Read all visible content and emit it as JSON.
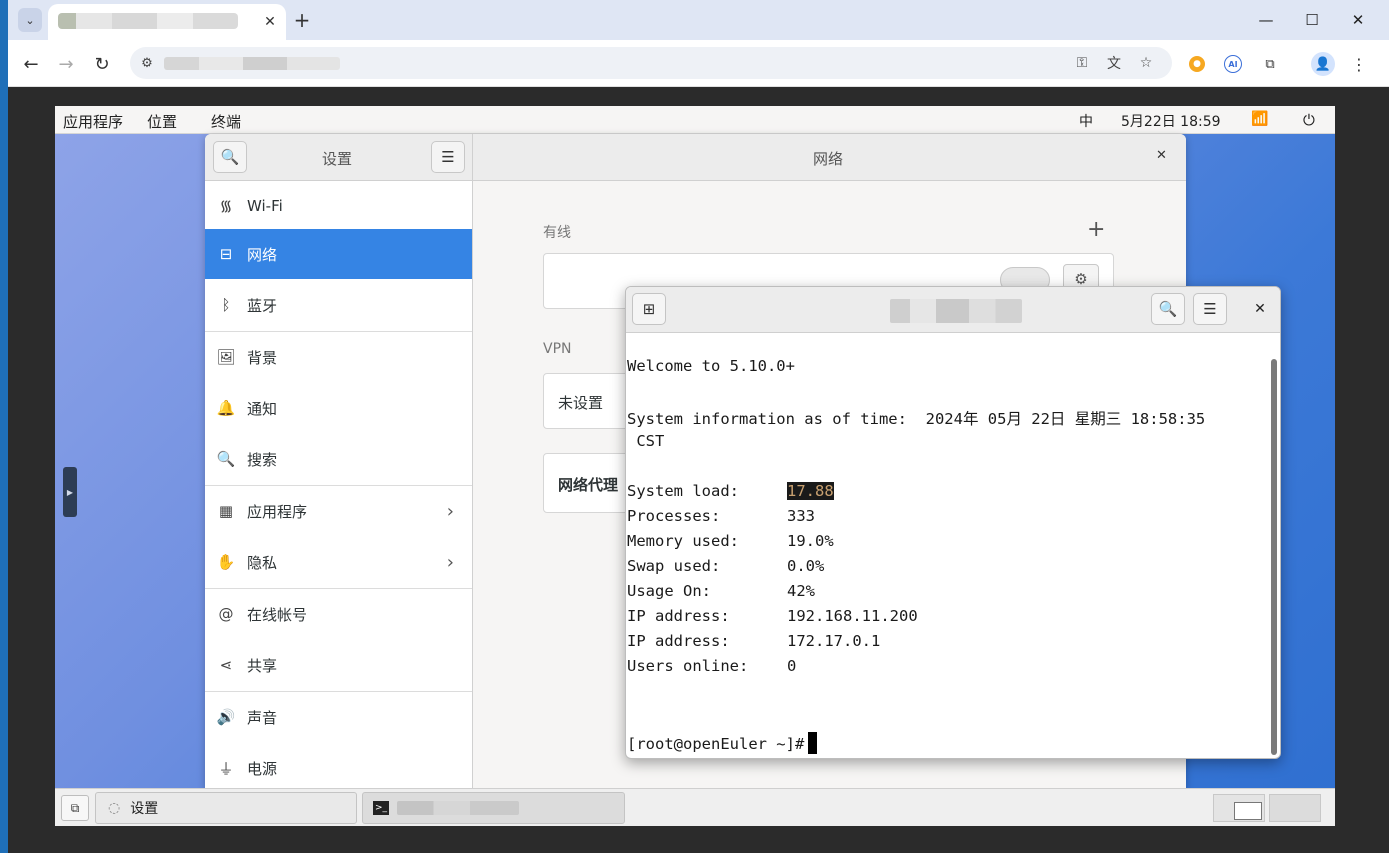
{
  "browser": {
    "tab_close_glyph": "✕",
    "new_tab_glyph": "+",
    "window_controls": [
      "—",
      "☐",
      "✕"
    ],
    "nav": {
      "back": "←",
      "forward": "→",
      "reload": "↻"
    },
    "omnibox_icons": [
      "key-icon",
      "translate-icon",
      "star-icon"
    ],
    "extensions": [
      "shield-extension-icon",
      "ai-extension-icon",
      "puzzle-icon"
    ]
  },
  "desktop": {
    "topbar": {
      "menus": [
        "应用程序",
        "位置",
        "终端"
      ],
      "input_method": "中",
      "datetime": "5月22日 18:59"
    }
  },
  "settings": {
    "header_title": "设置",
    "panel_title": "网络",
    "sidebar": [
      {
        "label": "Wi-Fi",
        "icon": "wifi-icon"
      },
      {
        "label": "网络",
        "icon": "network-icon",
        "active": true
      },
      {
        "label": "蓝牙",
        "icon": "bluetooth-icon"
      },
      {
        "label": "背景",
        "icon": "background-icon"
      },
      {
        "label": "通知",
        "icon": "bell-icon"
      },
      {
        "label": "搜索",
        "icon": "search-icon"
      },
      {
        "label": "应用程序",
        "icon": "apps-icon",
        "chevron": true
      },
      {
        "label": "隐私",
        "icon": "hand-icon",
        "chevron": true
      },
      {
        "label": "在线帐号",
        "icon": "at-icon"
      },
      {
        "label": "共享",
        "icon": "share-icon"
      },
      {
        "label": "声音",
        "icon": "speaker-icon"
      },
      {
        "label": "电源",
        "icon": "power-plug-icon"
      }
    ],
    "content": {
      "wired_title": "有线",
      "add_glyph": "+",
      "vpn_title": "VPN",
      "vpn_status": "未设置",
      "proxy_label": "网络代理"
    }
  },
  "terminal": {
    "lines": [
      "Welcome to 5.10.0+",
      "",
      "System information as of time:  2024年 05月 22日 星期三 18:58:35",
      " CST",
      ""
    ],
    "stats": [
      {
        "label": "System load:",
        "value": "17.88",
        "highlight": true
      },
      {
        "label": "Processes:",
        "value": "333"
      },
      {
        "label": "Memory used:",
        "value": "19.0%"
      },
      {
        "label": "Swap used:",
        "value": "0.0%"
      },
      {
        "label": "Usage On:",
        "value": "42%"
      },
      {
        "label": "IP address:",
        "value": "192.168.11.200"
      },
      {
        "label": "IP address:",
        "value": "172.17.0.1"
      },
      {
        "label": "Users online:",
        "value": "0"
      }
    ],
    "prompt": "[root@openEuler ~]#"
  },
  "taskbar": {
    "settings_label": "设置"
  },
  "colors": {
    "accent": "#3584e4",
    "desktop_gradient_start": "#8fa4e8",
    "desktop_gradient_end": "#2f6fd0"
  }
}
